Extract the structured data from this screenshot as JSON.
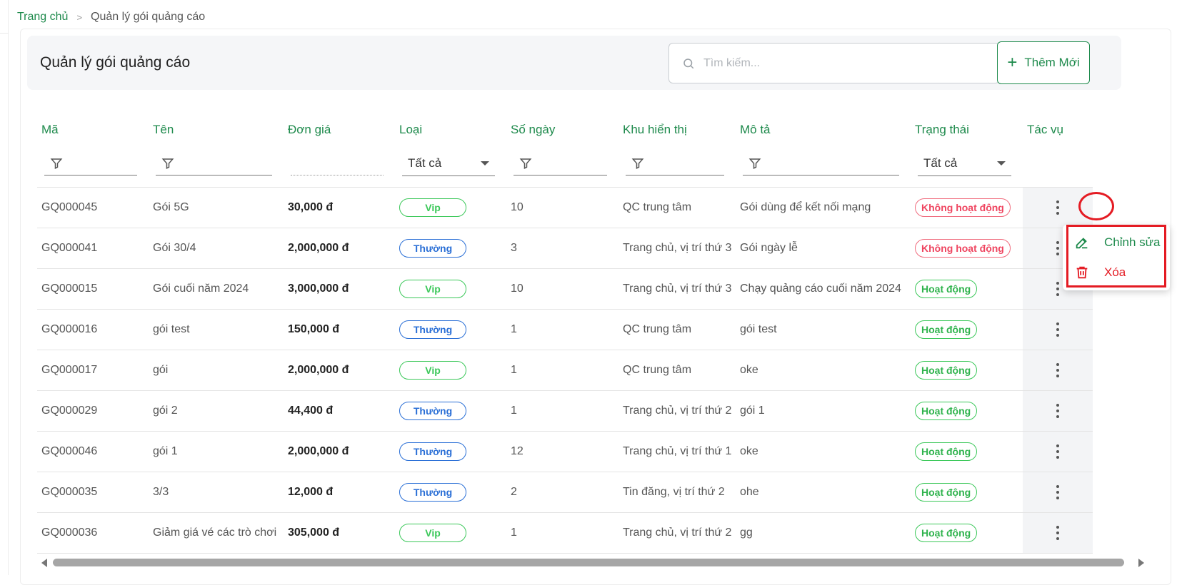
{
  "breadcrumb": {
    "home": "Trang chủ",
    "separator": ">",
    "current": "Quản lý gói quảng cáo"
  },
  "header": {
    "title": "Quản lý gói quảng cáo",
    "search_placeholder": "Tìm kiếm...",
    "add_label": "Thêm Mới"
  },
  "columns": [
    "Mã",
    "Tên",
    "Đơn giá",
    "Loại",
    "Số ngày",
    "Khu hiển thị",
    "Mô tả",
    "Trạng thái",
    "Tác vụ"
  ],
  "filters": {
    "type_select": "Tất cả",
    "status_select": "Tất cả"
  },
  "rows": [
    {
      "code": "GQ000045",
      "name": "Gói 5G",
      "price": "30,000 đ",
      "type": "Vip",
      "days": "10",
      "area": "QC trung tâm",
      "desc": "Gói dùng để kết nối mạng",
      "status": "Không hoạt động"
    },
    {
      "code": "GQ000041",
      "name": "Gói 30/4",
      "price": "2,000,000 đ",
      "type": "Thường",
      "days": "3",
      "area": "Trang chủ, vị trí thứ 3",
      "desc": "Gói ngày lễ",
      "status": "Không hoạt động"
    },
    {
      "code": "GQ000015",
      "name": "Gói cuối năm 2024",
      "price": "3,000,000 đ",
      "type": "Vip",
      "days": "10",
      "area": "Trang chủ, vị trí thứ 3",
      "desc": "Chạy quảng cáo cuối năm 2024",
      "status": "Hoạt động"
    },
    {
      "code": "GQ000016",
      "name": "gói test",
      "price": "150,000 đ",
      "type": "Thường",
      "days": "1",
      "area": "QC trung tâm",
      "desc": "gói test",
      "status": "Hoạt động"
    },
    {
      "code": "GQ000017",
      "name": "gói",
      "price": "2,000,000 đ",
      "type": "Vip",
      "days": "1",
      "area": "QC trung tâm",
      "desc": "oke",
      "status": "Hoạt động"
    },
    {
      "code": "GQ000029",
      "name": "gói 2",
      "price": "44,400 đ",
      "type": "Thường",
      "days": "1",
      "area": "Trang chủ, vị trí thứ 2",
      "desc": "gói 1",
      "status": "Hoạt động"
    },
    {
      "code": "GQ000046",
      "name": "gói 1",
      "price": "2,000,000 đ",
      "type": "Thường",
      "days": "12",
      "area": "Trang chủ, vị trí thứ 1",
      "desc": "oke",
      "status": "Hoạt động"
    },
    {
      "code": "GQ000035",
      "name": "3/3",
      "price": "12,000 đ",
      "type": "Thường",
      "days": "2",
      "area": "Tin đăng, vị trí thứ 2",
      "desc": "ohe",
      "status": "Hoạt động"
    },
    {
      "code": "GQ000036",
      "name": "Giảm giá vé các trò chơi",
      "price": "305,000 đ",
      "type": "Vip",
      "days": "1",
      "area": "Trang chủ, vị trí thứ 2",
      "desc": "gg",
      "status": "Hoạt động"
    }
  ],
  "context_menu": {
    "edit_label": "Chỉnh sửa",
    "delete_label": "Xóa"
  },
  "colors": {
    "accent": "#1e8a4c",
    "vip": "#3cc85a",
    "normal": "#2a6fd6",
    "inactive": "#ef4560",
    "highlight": "#e41b23"
  }
}
